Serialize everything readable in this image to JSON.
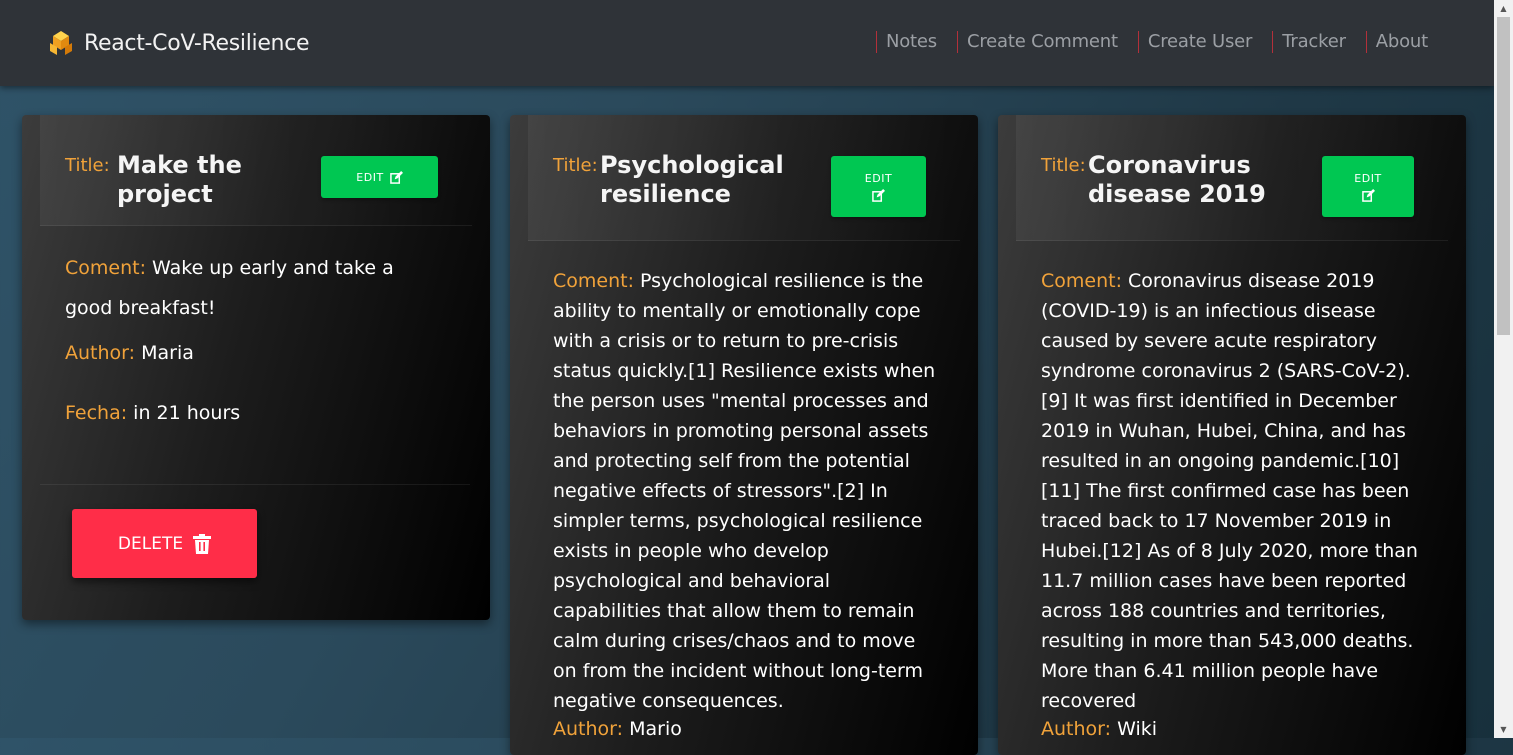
{
  "brand": {
    "name": "React-CoV-Resilience",
    "icon": "cube-logo-icon"
  },
  "nav": [
    "Notes",
    "Create Comment",
    "Create User",
    "Tracker",
    "About"
  ],
  "labels": {
    "title": "Title:",
    "comment": "Coment:",
    "author": "Author:",
    "date": "Fecha:",
    "edit": "EDIT",
    "delete": "DELETE"
  },
  "notes": [
    {
      "title": "Make the project",
      "comment": "Wake up early and take a good breakfast!",
      "author": "Maria",
      "date": "in 21 hours"
    },
    {
      "title": "Psychological resilience",
      "comment": "Psychological resilience is the ability to mentally or emotionally cope with a crisis or to return to pre-crisis status quickly.[1] Resilience exists when the person uses \"mental processes and behaviors in promoting personal assets and protecting self from the potential negative effects of stressors\".[2] In simpler terms, psychological resilience exists in people who develop psychological and behavioral capabilities that allow them to remain calm during crises/chaos and to move on from the incident without long-term negative consequences.",
      "author": "Mario"
    },
    {
      "title": "Coronavirus disease 2019",
      "comment": "Coronavirus disease 2019 (COVID-19) is an infectious disease caused by severe acute respiratory syndrome coronavirus 2 (SARS-CoV-2).[9] It was first identified in December 2019 in Wuhan, Hubei, China, and has resulted in an ongoing pandemic.[10][11] The first confirmed case has been traced back to 17 November 2019 in Hubei.[12] As of 8 July 2020, more than 11.7 million cases have been reported across 188 countries and territories, resulting in more than 543,000 deaths. More than 6.41 million people have recovered",
      "author": "Wiki"
    }
  ]
}
